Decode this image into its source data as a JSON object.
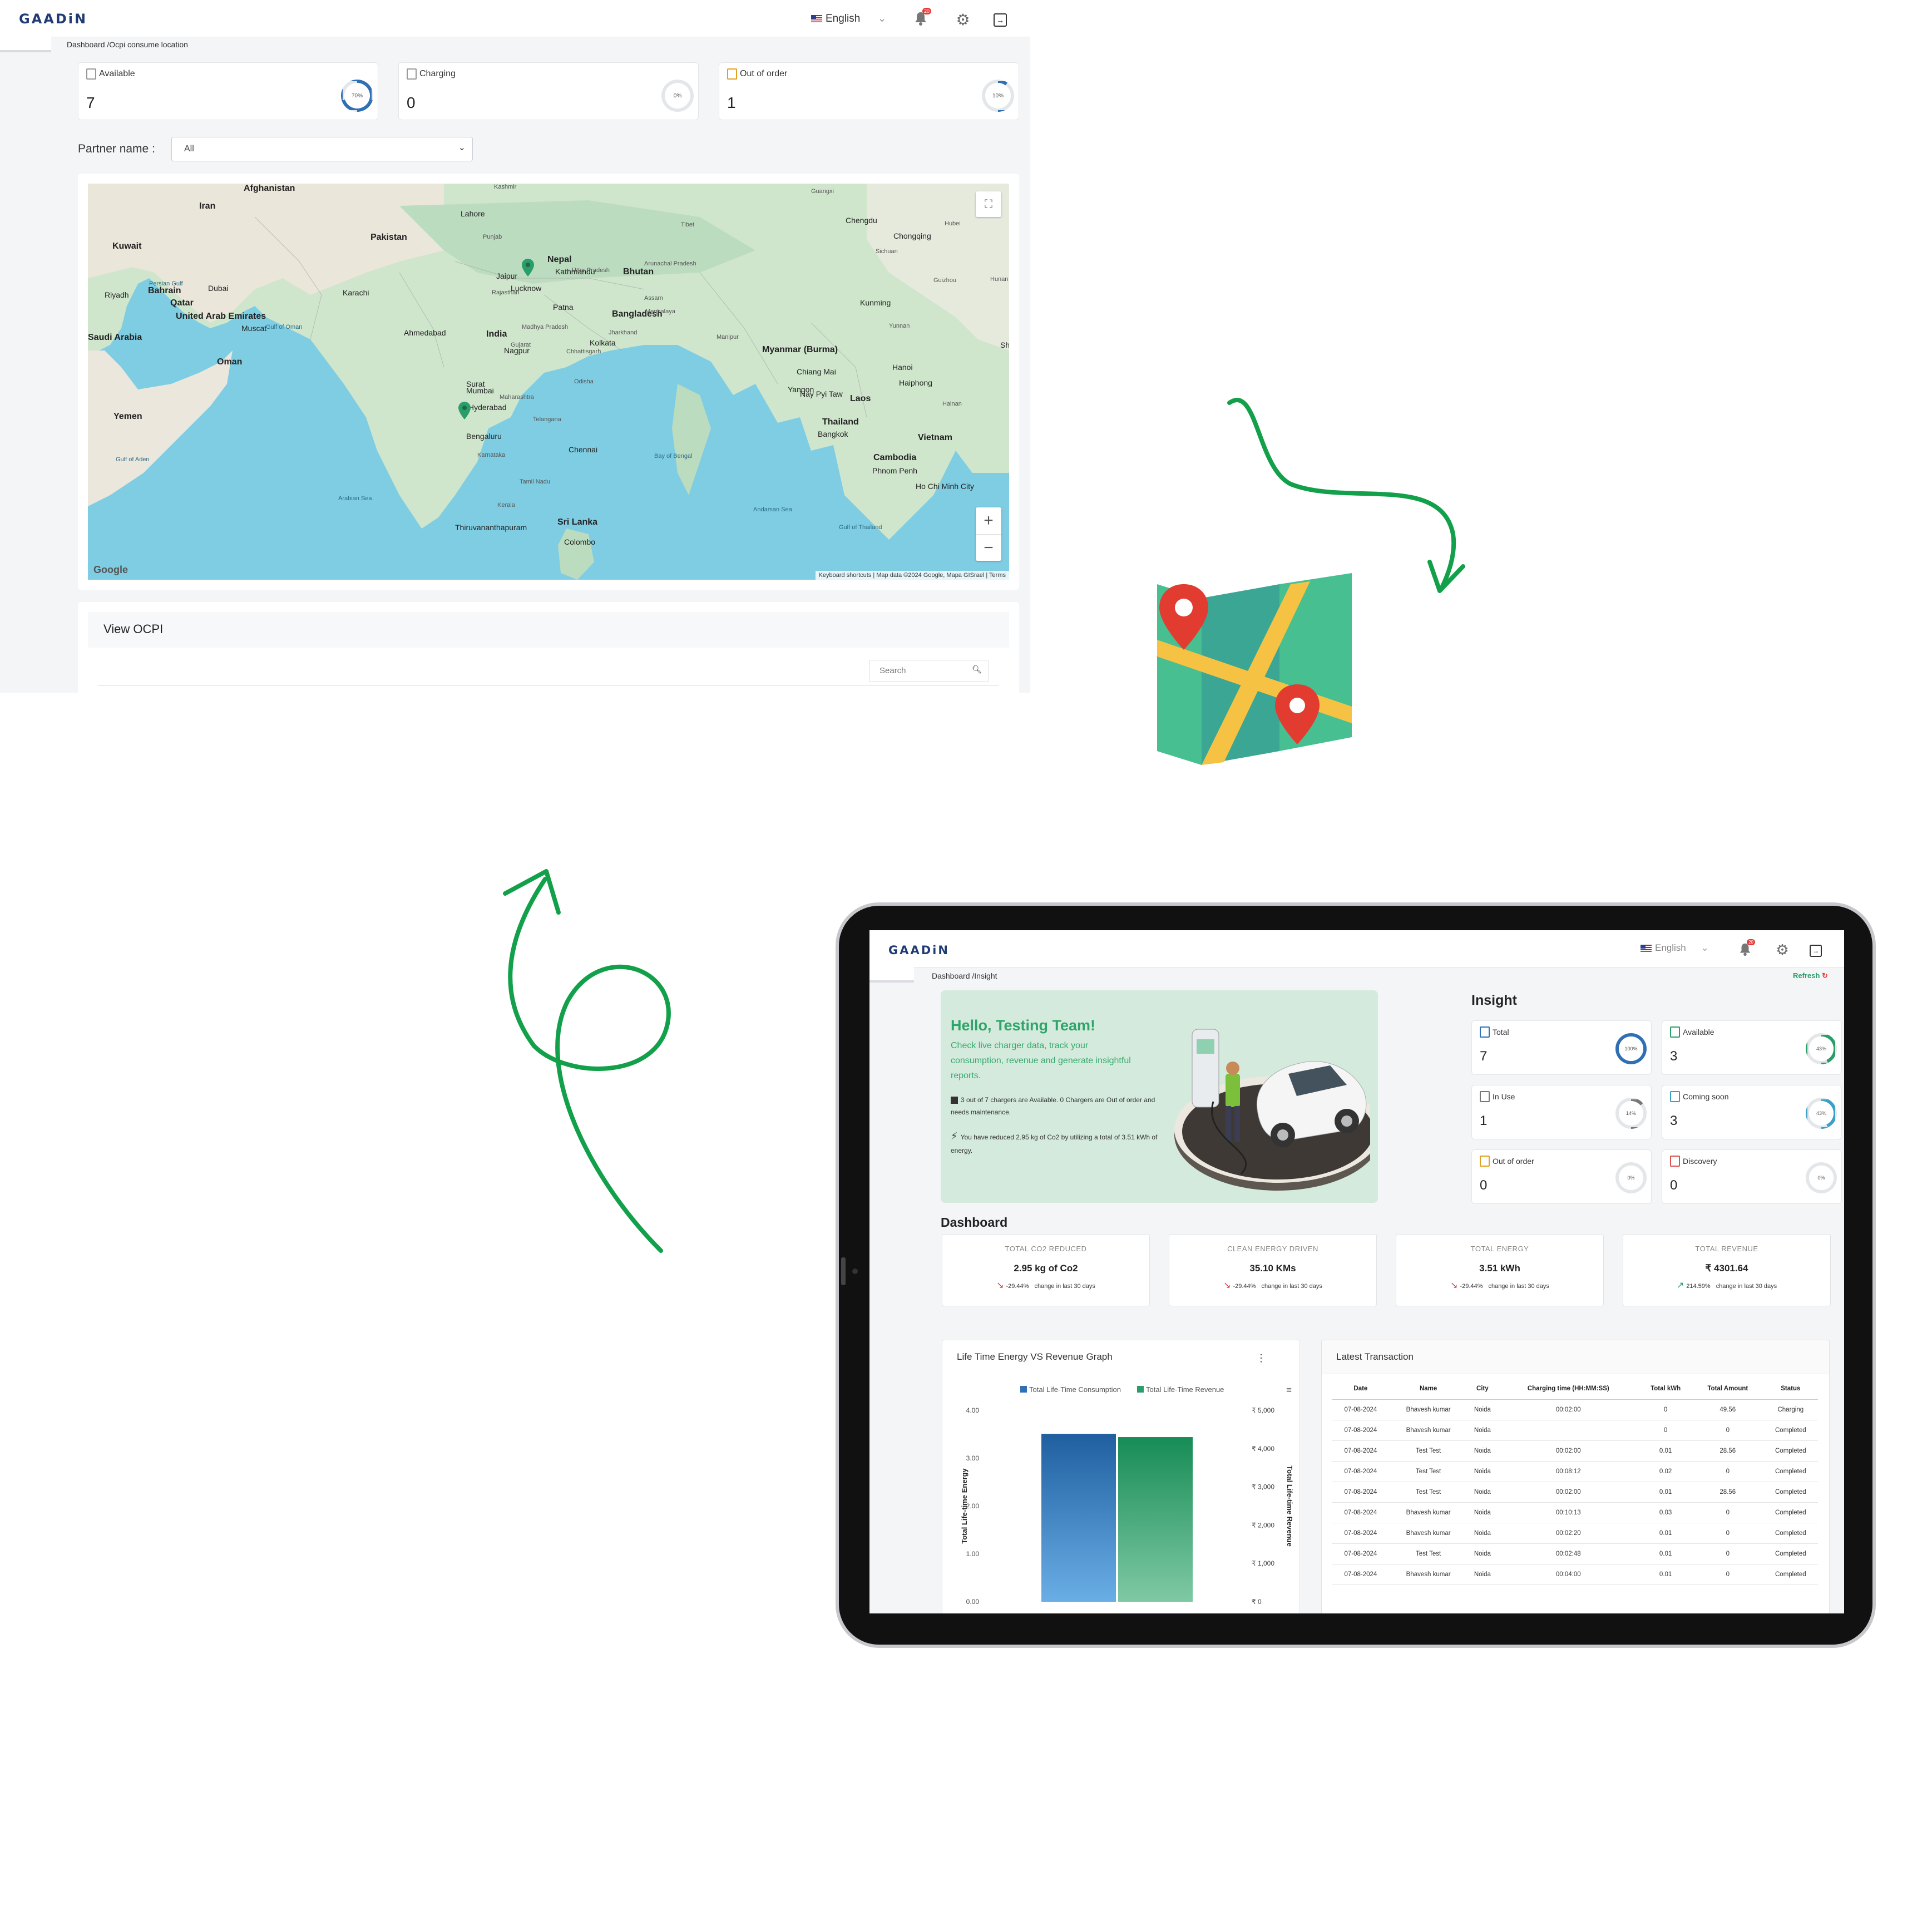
{
  "screen1": {
    "logo": "GAADiN",
    "language": "English",
    "notification_count": "20",
    "breadcrumb": "Dashboard /Ocpi consume location",
    "cards": [
      {
        "label": "Available",
        "value": "7",
        "percent_text": "70%",
        "color": "#2f6fb3",
        "fraction": 0.7
      },
      {
        "label": "Charging",
        "value": "0",
        "percent_text": "0%",
        "color": "#2f6fb3",
        "fraction": 0.0
      },
      {
        "label": "Out of order",
        "value": "1",
        "percent_text": "10%",
        "color": "#2f6fb3",
        "fraction": 0.1
      }
    ],
    "partner_label": "Partner name :",
    "partner_value": "All",
    "map": {
      "labels": [
        "Afghanistan",
        "Iran",
        "Kuwait",
        "Pakistan",
        "Nepal",
        "Bhutan",
        "Riyadh",
        "Bahrain",
        "Qatar",
        "Dubai",
        "Karachi",
        "United Arab Emirates",
        "Muscat",
        "Oman",
        "Yemen",
        "Gulf of Aden",
        "India",
        "Ahmedabad",
        "Lucknow",
        "Patna",
        "Kathmandu",
        "Bangladesh",
        "Kolkata",
        "Nagpur",
        "Surat",
        "Mumbai",
        "Hyderabad",
        "Bengaluru",
        "Chennai",
        "Sri Lanka",
        "Colombo",
        "Thiruvananthapuram",
        "Myanmar (Burma)",
        "Thailand",
        "Bangkok",
        "Laos",
        "Vietnam",
        "Cambodia",
        "Ho Chi Minh City",
        "Chengdu",
        "Chongqing",
        "Kunming",
        "Hanoi",
        "Haiphong",
        "Lahore",
        "Jaipur",
        "Bay of Bengal",
        "Arabian Sea",
        "Andaman Sea",
        "Gulf of Oman",
        "Persian Gulf",
        "Gulf of Thailand",
        "Saudi Arabia",
        "Yangon",
        "Chiang Mai",
        "Nay Pyi Taw",
        "Guangxi",
        "Hubei",
        "Hunan",
        "Guizhou",
        "Sichuan",
        "Tibet",
        "Kashmir",
        "Punjab",
        "Rajasthan",
        "Gujarat",
        "Maharashtra",
        "Telangana",
        "Karnataka",
        "Kerala",
        "Tamil Nadu",
        "Madhya Pradesh",
        "Chhattisgarh",
        "Odisha",
        "Jharkhand",
        "Uttar Pradesh",
        "Assam",
        "Meghalaya",
        "Manipur",
        "Arunachal Pradesh",
        "Yunnan",
        "Hainan",
        "Shenzhen",
        "Phnom Penh"
      ],
      "attribution": "Keyboard shortcuts  |  Map data ©2024 Google, Mapa GISrael  |  Terms",
      "google": "Google"
    },
    "view_title": "View OCPI",
    "search_placeholder": "Search"
  },
  "screen2": {
    "logo": "GAADiN",
    "language": "English",
    "notification_count": "20",
    "breadcrumb": "Dashboard /Insight",
    "refresh": "Refresh",
    "hello_title": "Hello, Testing Team!",
    "hello_sub": "Check live charger data, track your consumption, revenue and generate insightful reports.",
    "note1": "3 out of 7 chargers are Available. 0 Chargers are Out of order and needs maintenance.",
    "note2": "You have reduced 2.95 kg of Co2 by utilizing a total of 3.51 kWh of energy.",
    "insight_title": "Insight",
    "insight": [
      {
        "label": "Total",
        "value": "7",
        "percent_text": "100%",
        "color": "#2f6fb3",
        "fraction": 1.0
      },
      {
        "label": "Available",
        "value": "3",
        "percent_text": "43%",
        "color": "#2a9d6a",
        "fraction": 0.43
      },
      {
        "label": "In Use",
        "value": "1",
        "percent_text": "14%",
        "color": "#777777",
        "fraction": 0.14
      },
      {
        "label": "Coming soon",
        "value": "3",
        "percent_text": "43%",
        "color": "#3aa0c8",
        "fraction": 0.43
      },
      {
        "label": "Out of order",
        "value": "0",
        "percent_text": "0%",
        "color": "#e0a020",
        "fraction": 0.0
      },
      {
        "label": "Discovery",
        "value": "0",
        "percent_text": "0%",
        "color": "#d9534f",
        "fraction": 0.0
      }
    ],
    "dashboard_title": "Dashboard",
    "kpis": [
      {
        "title": "TOTAL CO2 REDUCED",
        "value": "2.95 kg of Co2",
        "change": "-29.44%",
        "note": "change in last 30 days",
        "trend": "down"
      },
      {
        "title": "CLEAN ENERGY DRIVEN",
        "value": "35.10 KMs",
        "change": "-29.44%",
        "note": "change in last 30 days",
        "trend": "down"
      },
      {
        "title": "TOTAL ENERGY",
        "value": "3.51 kWh",
        "change": "-29.44%",
        "note": "change in last 30 days",
        "trend": "down"
      },
      {
        "title": "TOTAL REVENUE",
        "value": "₹ 4301.64",
        "change": "214.59%",
        "note": "change in last 30 days",
        "trend": "up"
      }
    ],
    "graph_title": "Life Time Energy VS Revenue Graph",
    "chart_data": {
      "type": "bar",
      "categories": [
        ""
      ],
      "series": [
        {
          "name": "Total Life-Time Consumption",
          "values": [
            3.51
          ],
          "axis": "left",
          "color": "#2f6fb3"
        },
        {
          "name": "Total Life-Time Revenue",
          "values": [
            4301.64
          ],
          "axis": "right",
          "color": "#2a9d6a"
        }
      ],
      "ylabel": "Total Life-time Energy",
      "y2label": "Total Life-time Revenue",
      "yticks": [
        "4.00",
        "3.00",
        "2.00",
        "1.00",
        "0.00"
      ],
      "y2ticks": [
        "₹ 5,000",
        "₹ 4,000",
        "₹ 3,000",
        "₹ 2,000",
        "₹ 1,000",
        "₹ 0"
      ],
      "ylim": [
        0,
        4
      ],
      "y2lim": [
        0,
        5000
      ]
    },
    "tx_title": "Latest Transaction",
    "tx_headers": [
      "Date",
      "Name",
      "City",
      "Charging time (HH:MM:SS)",
      "Total kWh",
      "Total Amount",
      "Status"
    ],
    "tx_rows": [
      [
        "07-08-2024",
        "Bhavesh kumar",
        "Noida",
        "00:02:00",
        "0",
        "49.56",
        "Charging"
      ],
      [
        "07-08-2024",
        "Bhavesh kumar",
        "Noida",
        "",
        "0",
        "0",
        "Completed"
      ],
      [
        "07-08-2024",
        "Test Test",
        "Noida",
        "00:02:00",
        "0.01",
        "28.56",
        "Completed"
      ],
      [
        "07-08-2024",
        "Test Test",
        "Noida",
        "00:08:12",
        "0.02",
        "0",
        "Completed"
      ],
      [
        "07-08-2024",
        "Test Test",
        "Noida",
        "00:02:00",
        "0.01",
        "28.56",
        "Completed"
      ],
      [
        "07-08-2024",
        "Bhavesh kumar",
        "Noida",
        "00:10:13",
        "0.03",
        "0",
        "Completed"
      ],
      [
        "07-08-2024",
        "Bhavesh kumar",
        "Noida",
        "00:02:20",
        "0.01",
        "0",
        "Completed"
      ],
      [
        "07-08-2024",
        "Test Test",
        "Noida",
        "00:02:48",
        "0.01",
        "0",
        "Completed"
      ],
      [
        "07-08-2024",
        "Bhavesh kumar",
        "Noida",
        "00:04:00",
        "0.01",
        "0",
        "Completed"
      ]
    ]
  }
}
